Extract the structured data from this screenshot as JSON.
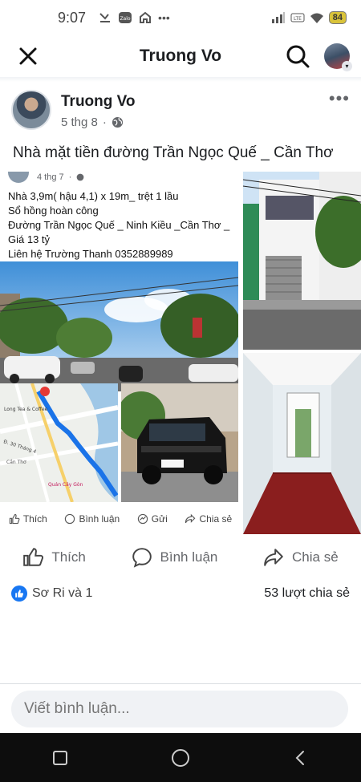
{
  "status_bar": {
    "time": "9:07",
    "battery": "84"
  },
  "app_bar": {
    "title": "Truong Vo"
  },
  "post": {
    "author": "Truong Vo",
    "date": "5 thg 8",
    "more": "•••",
    "text": "Nhà mặt tiền đường Trần Ngọc Quế _ Cần Thơ",
    "shared": {
      "date": "4 thg 7",
      "lines": [
        "Nhà 3,9m( hậu 4,1) x 19m_  trệt 1 lầu",
        "Sổ hồng hoàn công",
        "Đường Trần Ngọc Quế _ Ninh Kiều _Cần Thơ _",
        "Giá 13 tỷ",
        "Liên hệ Trường Thanh 0352889989"
      ],
      "actions": {
        "like": "Thích",
        "comment": "Bình luận",
        "send": "Gửi",
        "share": "Chia sẻ"
      },
      "map_labels": [
        "Long Tea & Coffee",
        "Đ. 30 Tháng 4",
        "Quán Cây Gòn",
        "Cần Thơ"
      ]
    },
    "actions": {
      "like": "Thích",
      "comment": "Bình luận",
      "share": "Chia sẻ"
    },
    "reactions": {
      "people": "Sơ Ri và 1",
      "shares": "53 lượt chia sẻ"
    }
  },
  "comment_box": {
    "placeholder": "Viết bình luận..."
  },
  "colors": {
    "accent": "#1877f2",
    "text": "#1c1e21",
    "muted": "#65676b",
    "nav": "#0d0d0d"
  }
}
